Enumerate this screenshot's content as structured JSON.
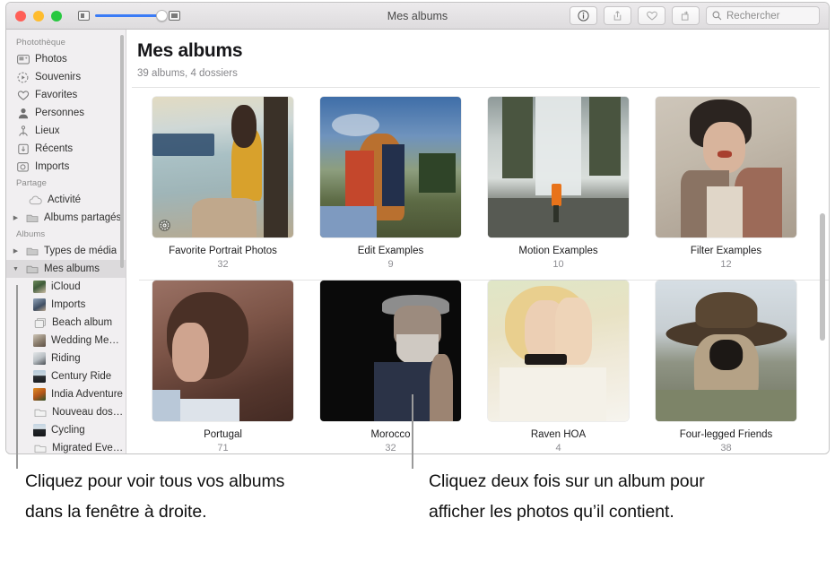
{
  "window": {
    "title": "Mes albums",
    "traffic_lights": [
      "close",
      "minimize",
      "zoom"
    ],
    "zoom_slider": {
      "min_icon": "small-thumbnail-icon",
      "max_icon": "large-thumbnail-icon",
      "value": 100
    },
    "toolbar": {
      "info_label": "info-icon",
      "share_label": "share-icon",
      "favorite_label": "heart-icon",
      "rotate_label": "rotate-icon",
      "search": {
        "placeholder": "Rechercher",
        "value": "",
        "icon": "search-icon"
      }
    }
  },
  "sidebar": {
    "groups": [
      {
        "title": "Photothèque",
        "items": [
          {
            "label": "Photos",
            "icon": "photos-icon"
          },
          {
            "label": "Souvenirs",
            "icon": "memories-icon"
          },
          {
            "label": "Favorites",
            "icon": "heart-icon"
          },
          {
            "label": "Personnes",
            "icon": "person-icon"
          },
          {
            "label": "Lieux",
            "icon": "places-pin-icon"
          },
          {
            "label": "Récents",
            "icon": "recents-download-icon"
          },
          {
            "label": "Imports",
            "icon": "imports-camera-icon"
          }
        ]
      },
      {
        "title": "Partage",
        "items": [
          {
            "label": "Activité",
            "icon": "cloud-icon"
          },
          {
            "label": "Albums partagés",
            "icon": "folder-icon",
            "disclosure": "collapsed"
          }
        ]
      },
      {
        "title": "Albums",
        "items": [
          {
            "label": "Types de média",
            "icon": "folder-icon",
            "disclosure": "collapsed"
          },
          {
            "label": "Mes albums",
            "icon": "folder-icon",
            "disclosure": "expanded",
            "selected": true
          },
          {
            "label": "iCloud",
            "icon": "album-thumb",
            "indent": true,
            "swatch": "#5d7b54"
          },
          {
            "label": "Imports",
            "icon": "album-thumb",
            "indent": true,
            "swatch": "#5f6f85"
          },
          {
            "label": "Beach album",
            "icon": "stacked-album-icon",
            "indent": true
          },
          {
            "label": "Wedding Mem…",
            "icon": "album-thumb",
            "indent": true,
            "swatch": "#a9a097"
          },
          {
            "label": "Riding",
            "icon": "album-thumb",
            "indent": true,
            "swatch": "#cfd2d4"
          },
          {
            "label": "Century Ride",
            "icon": "album-thumb",
            "indent": true,
            "swatch": "#6f87a0"
          },
          {
            "label": "India Adventure",
            "icon": "album-thumb",
            "indent": true,
            "swatch": "#b4641a"
          },
          {
            "label": "Nouveau dossier",
            "icon": "folder-icon",
            "indent": true
          },
          {
            "label": "Cycling",
            "icon": "album-thumb",
            "indent": true,
            "swatch": "#8fa6bd"
          },
          {
            "label": "Migrated Events",
            "icon": "folder-icon",
            "indent": true
          }
        ]
      }
    ]
  },
  "main": {
    "title": "Mes albums",
    "subtitle": "39 albums, 4 dossiers",
    "albums": [
      {
        "name": "Favorite Portrait Photos",
        "count": "32",
        "badge": "gear-icon",
        "colors": [
          "#d8cfb4",
          "#8fb0b8",
          "#2f3f52",
          "#d9a33a"
        ]
      },
      {
        "name": "Edit Examples",
        "count": "9",
        "colors": [
          "#4a6f9a",
          "#b9c6d4",
          "#3a4a2c",
          "#c4472c"
        ]
      },
      {
        "name": "Motion Examples",
        "count": "10",
        "colors": [
          "#9ba3a3",
          "#d8dcdb",
          "#3a4239",
          "#e8731a"
        ]
      },
      {
        "name": "Filter Examples",
        "count": "12",
        "colors": [
          "#cfc8bd",
          "#7d6756",
          "#3a3230",
          "#9c6a58"
        ]
      },
      {
        "name": "Portugal",
        "count": "71",
        "colors": [
          "#8e6a5e",
          "#4a3028",
          "#c2a091",
          "#d9dde2"
        ]
      },
      {
        "name": "Morocco",
        "count": "32",
        "colors": [
          "#0b0b0b",
          "#2b3347",
          "#8d8d8d",
          "#6b6460"
        ]
      },
      {
        "name": "Raven HOA",
        "count": "4",
        "colors": [
          "#dfe3c8",
          "#f2e3c3",
          "#f7f4ec",
          "#2a2622"
        ]
      },
      {
        "name": "Four-legged Friends",
        "count": "38",
        "colors": [
          "#cdd6dc",
          "#4a3a2b",
          "#b8a585",
          "#7d8b6a"
        ]
      }
    ]
  },
  "callouts": [
    {
      "text": "Cliquez pour voir tous vos albums dans la fenêtre à droite."
    },
    {
      "text": "Cliquez deux fois sur un album pour afficher les photos qu’il contient."
    }
  ]
}
